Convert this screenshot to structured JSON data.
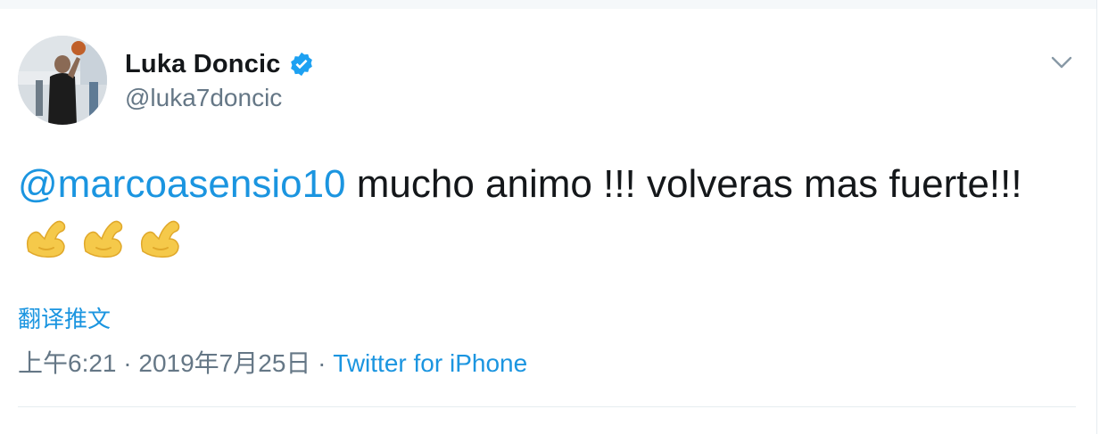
{
  "tweet": {
    "author": {
      "display_name": "Luka Doncic",
      "handle": "@luka7doncic",
      "verified": true
    },
    "text": {
      "mention": "@marcoasensio10",
      "body": " mucho animo !!! volveras mas fuerte!!!",
      "emojis": [
        "flexed-biceps",
        "flexed-biceps",
        "flexed-biceps"
      ]
    },
    "translate_label": "翻译推文",
    "meta": {
      "timestamp": "上午6:21 · 2019年7月25日 · ",
      "source": "Twitter for iPhone"
    },
    "colors": {
      "link": "#1b95e0",
      "verified": "#1da1f2",
      "secondary_text": "#657786"
    }
  }
}
